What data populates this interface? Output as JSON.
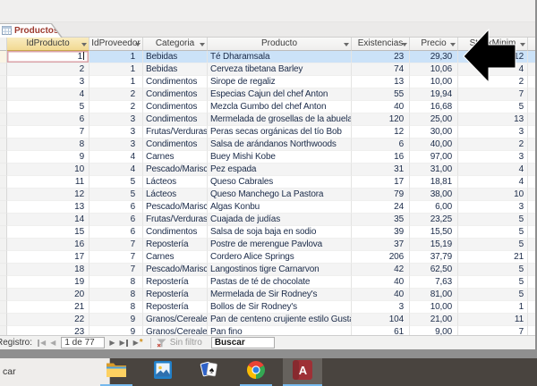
{
  "window": {
    "tab": {
      "label": "Productos"
    }
  },
  "table": {
    "columns": [
      {
        "key": "idproducto",
        "label": "IdProducto",
        "sorted": true
      },
      {
        "key": "idproveedor",
        "label": "IdProveedor",
        "sorted": false
      },
      {
        "key": "categoria",
        "label": "Categoria",
        "sorted": false
      },
      {
        "key": "producto",
        "label": "Producto",
        "sorted": false
      },
      {
        "key": "existencias",
        "label": "Existencias",
        "sorted": false
      },
      {
        "key": "precio",
        "label": "Precio",
        "sorted": false
      },
      {
        "key": "stockminim",
        "label": "StockMinim",
        "sorted": false
      }
    ],
    "rows": [
      [
        "1",
        "1",
        "Bebidas",
        "Té Dharamsala",
        "23",
        "29,30",
        "12"
      ],
      [
        "2",
        "1",
        "Bebidas",
        "Cerveza tibetana Barley",
        "74",
        "10,06",
        "4"
      ],
      [
        "3",
        "1",
        "Condimentos",
        "Sirope de regaliz",
        "13",
        "10,00",
        "2"
      ],
      [
        "4",
        "2",
        "Condimentos",
        "Especias Cajun del chef Anton",
        "55",
        "19,94",
        "7"
      ],
      [
        "5",
        "2",
        "Condimentos",
        "Mezcla Gumbo del chef Anton",
        "40",
        "16,68",
        "5"
      ],
      [
        "6",
        "3",
        "Condimentos",
        "Mermelada de grosellas de la abuela",
        "120",
        "25,00",
        "13"
      ],
      [
        "7",
        "3",
        "Frutas/Verduras",
        "Peras secas orgánicas del tío Bob",
        "12",
        "30,00",
        "3"
      ],
      [
        "8",
        "3",
        "Condimentos",
        "Salsa de arándanos Northwoods",
        "6",
        "40,00",
        "2"
      ],
      [
        "9",
        "4",
        "Carnes",
        "Buey Mishi Kobe",
        "16",
        "97,00",
        "3"
      ],
      [
        "10",
        "4",
        "Pescado/Mariscos",
        "Pez espada",
        "31",
        "31,00",
        "4"
      ],
      [
        "11",
        "5",
        "Lácteos",
        "Queso Cabrales",
        "17",
        "18,81",
        "4"
      ],
      [
        "12",
        "5",
        "Lácteos",
        "Queso Manchego La Pastora",
        "79",
        "38,00",
        "10"
      ],
      [
        "13",
        "6",
        "Pescado/Mariscos",
        "Algas Konbu",
        "24",
        "6,00",
        "3"
      ],
      [
        "14",
        "6",
        "Frutas/Verduras",
        "Cuajada de judías",
        "35",
        "23,25",
        "5"
      ],
      [
        "15",
        "6",
        "Condimentos",
        "Salsa de soja baja en sodio",
        "39",
        "15,50",
        "5"
      ],
      [
        "16",
        "7",
        "Repostería",
        "Postre de merengue Pavlova",
        "37",
        "15,19",
        "5"
      ],
      [
        "17",
        "7",
        "Carnes",
        "Cordero Alice Springs",
        "206",
        "37,79",
        "21"
      ],
      [
        "18",
        "7",
        "Pescado/Mariscos",
        "Langostinos tigre Carnarvon",
        "42",
        "62,50",
        "5"
      ],
      [
        "19",
        "8",
        "Repostería",
        "Pastas de té de chocolate",
        "40",
        "7,63",
        "5"
      ],
      [
        "20",
        "8",
        "Repostería",
        "Mermelada de Sir Rodney's",
        "40",
        "81,00",
        "5"
      ],
      [
        "21",
        "8",
        "Repostería",
        "Bollos de Sir Rodney's",
        "3",
        "10,00",
        "1"
      ],
      [
        "22",
        "9",
        "Granos/Cereales",
        "Pan de centeno crujiente estilo Gustaf's",
        "104",
        "21,00",
        "11"
      ],
      [
        "23",
        "9",
        "Granos/Cereales",
        "Pan fino",
        "61",
        "9,00",
        "7"
      ]
    ],
    "selected_row_index": 0,
    "active_cell": {
      "row": 0,
      "col": 0,
      "value": "1"
    }
  },
  "record_navigator": {
    "label": "Registro:",
    "position": "1 de 77",
    "filter_status": "Sin filtro",
    "search_placeholder": "Buscar"
  },
  "taskbar": {
    "search_text": "car",
    "icons": [
      "file-explorer",
      "photos",
      "solitaire",
      "chrome",
      "access"
    ],
    "active_app": "access"
  },
  "colors": {
    "selected_row": "#cbe2f8",
    "selected_column_header": "#f2d992",
    "active_cell_border": "#dba3a9",
    "tab_text": "#9c392e",
    "taskbar_bg": "#49443f",
    "taskbar_underline": "#76b9ed",
    "access_icon_red": "#9e3036"
  }
}
